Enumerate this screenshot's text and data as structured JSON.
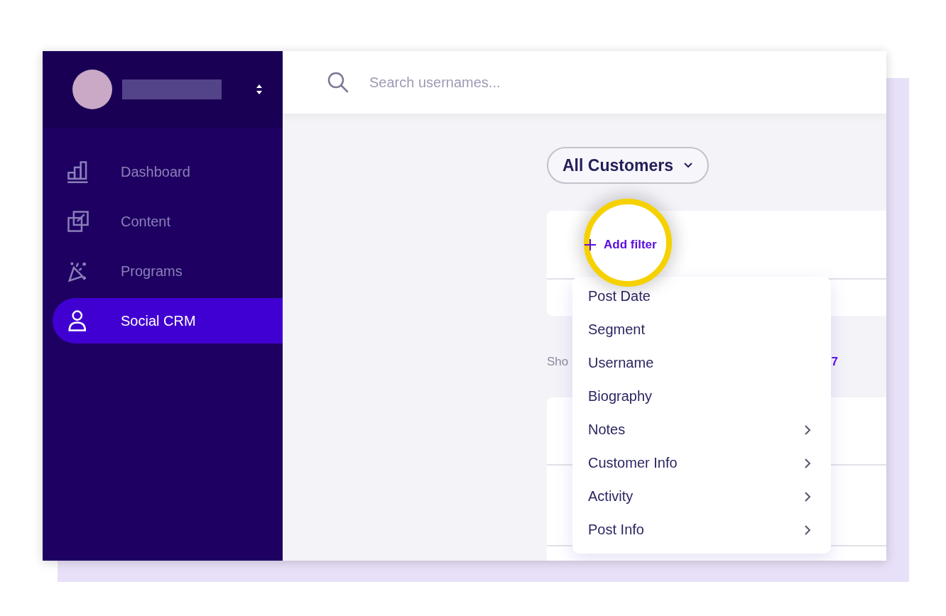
{
  "sidebar": {
    "items": [
      {
        "label": "Dashboard",
        "selected": false
      },
      {
        "label": "Content",
        "selected": false
      },
      {
        "label": "Programs",
        "selected": false
      },
      {
        "label": "Social CRM",
        "selected": true
      }
    ]
  },
  "search": {
    "placeholder": "Search usernames..."
  },
  "segment_button": {
    "label": "All Customers"
  },
  "filter_card": {
    "add_filter": "Add filter"
  },
  "results": {
    "text": "Sho",
    "count": "7"
  },
  "filter_menu": {
    "items": [
      {
        "label": "Post Date",
        "submenu": false
      },
      {
        "label": "Segment",
        "submenu": false
      },
      {
        "label": "Username",
        "submenu": false
      },
      {
        "label": "Biography",
        "submenu": false
      },
      {
        "label": "Notes",
        "submenu": true
      },
      {
        "label": "Customer Info",
        "submenu": true
      },
      {
        "label": "Activity",
        "submenu": true
      },
      {
        "label": "Post Info",
        "submenu": true
      }
    ]
  }
}
